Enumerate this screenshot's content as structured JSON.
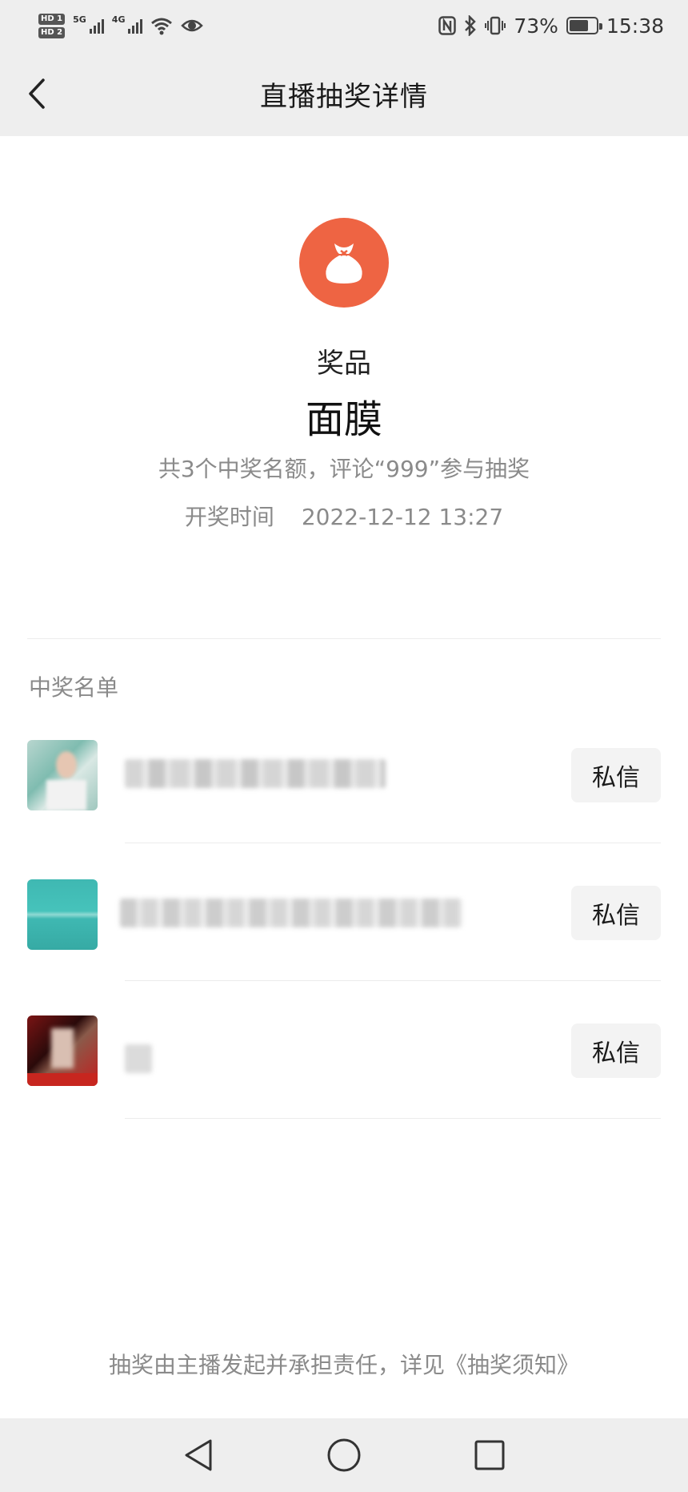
{
  "status_bar": {
    "hd1": "HD 1",
    "hd2": "HD 2",
    "net1": "5G",
    "net2": "4G",
    "battery_text": "73%",
    "battery_level": 0.73,
    "time": "15:38",
    "icons": [
      "signal-icon",
      "wifi-icon",
      "eye-icon",
      "nfc-icon",
      "bluetooth-icon",
      "vibrate-icon",
      "battery-icon"
    ]
  },
  "header": {
    "title": "直播抽奖详情",
    "back_icon": "chevron-left-icon"
  },
  "prize": {
    "icon": "gift-bag-icon",
    "label": "奖品",
    "name": "面膜",
    "description": "共3个中奖名额，评论“999”参与抽奖",
    "time_label": "开奖时间",
    "time_value": "2022-12-12 13:27"
  },
  "winners": {
    "title": "中奖名单",
    "items": [
      {
        "message_label": "私信"
      },
      {
        "message_label": "私信"
      },
      {
        "message_label": "私信"
      }
    ]
  },
  "footer": {
    "note": "抽奖由主播发起并承担责任，详见《抽奖须知》"
  },
  "system_nav": {
    "icons": [
      "back-triangle-icon",
      "home-circle-icon",
      "recents-square-icon"
    ]
  },
  "colors": {
    "accent": "#ee6443",
    "header_bg": "#eeeeee",
    "muted_text": "#8a8a8a",
    "button_bg": "#f3f3f3"
  }
}
